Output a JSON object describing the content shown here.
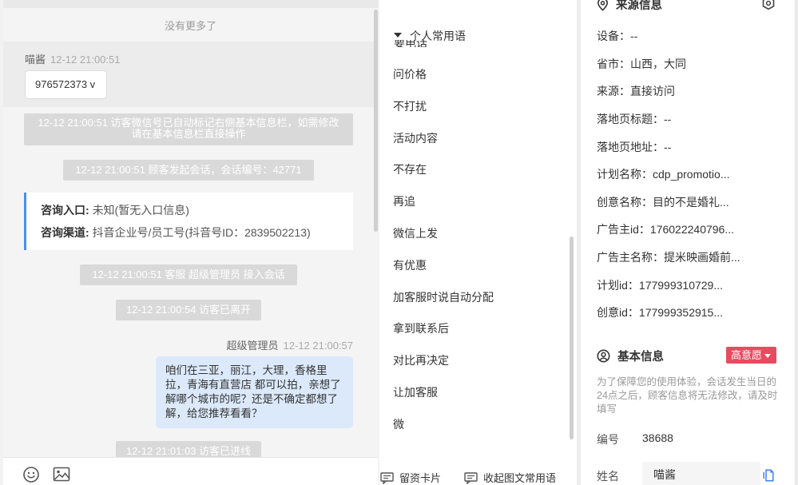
{
  "chat": {
    "no_more": "没有更多了",
    "guest_name": "喵酱",
    "guest_time": "12-12 21:00:51",
    "guest_message": "976572373 v",
    "system_1": "12-12 21:00:51 访客微信号已自动标记右侧基本信息栏，如需修改请在基本信息栏直接操作",
    "system_2": "12-12 21:00:51 顾客发起会话，会话编号：42771",
    "entry_label": "咨询入口:",
    "entry_value": "未知(暂无入口信息)",
    "channel_label": "咨询渠道:",
    "channel_value": "抖音企业号/员工号(抖音号ID：2839502213)",
    "system_3": "12-12 21:00:51 客服 超级管理员 接入会话",
    "system_4": "12-12 21:00:54 访客已离开",
    "agent_name": "超级管理员",
    "agent_time": "12-12 21:00:57",
    "agent_message": "咱们在三亚，丽江，大理，香格里拉，青海有直营店 都可以拍，亲想了解哪个城市的呢？还是不确定都想了解，给您推荐看看？",
    "system_5": "12-12 21:01:03 访客已进线"
  },
  "phrases": {
    "header": "个人常用语",
    "cut_item": "要电话",
    "items": [
      "问价格",
      "不打扰",
      "活动内容",
      "不存在",
      "再追",
      "微信上发",
      "有优惠",
      "加客服时说自动分配",
      "拿到联系后",
      "对比再决定",
      "让加客服",
      "微"
    ],
    "btn_card": "留资卡片",
    "btn_collapse": "收起图文常用语"
  },
  "source": {
    "title": "来源信息",
    "rows": [
      {
        "label": "设备：",
        "value": "--"
      },
      {
        "label": "省市：",
        "value": "山西，大同"
      },
      {
        "label": "来源：",
        "value": "直接访问"
      },
      {
        "label": "落地页标题：",
        "value": "--"
      },
      {
        "label": "落地页地址：",
        "value": "--"
      },
      {
        "label": "计划名称：",
        "value": "cdp_promotio..."
      },
      {
        "label": "创意名称：",
        "value": "目的不是婚礼..."
      },
      {
        "label": "广告主id：",
        "value": "176022240796..."
      },
      {
        "label": "广告主名称：",
        "value": "提米映画婚前..."
      },
      {
        "label": "计划id：",
        "value": "177999310729..."
      },
      {
        "label": "创意id：",
        "value": "177999352915..."
      }
    ]
  },
  "basic": {
    "title": "基本信息",
    "intent": "高意愿",
    "notice": "为了保障您的使用体验，会话发生当日的24点之后，顾客信息将无法修改，请及时填写",
    "id_label": "编号",
    "id_value": "38688",
    "name_label": "姓名",
    "name_value": "喵酱"
  },
  "colors": {
    "accent": "#4a8df6",
    "agent_bubble": "#dbe9fb",
    "intent_badge": "#e84a5f"
  }
}
